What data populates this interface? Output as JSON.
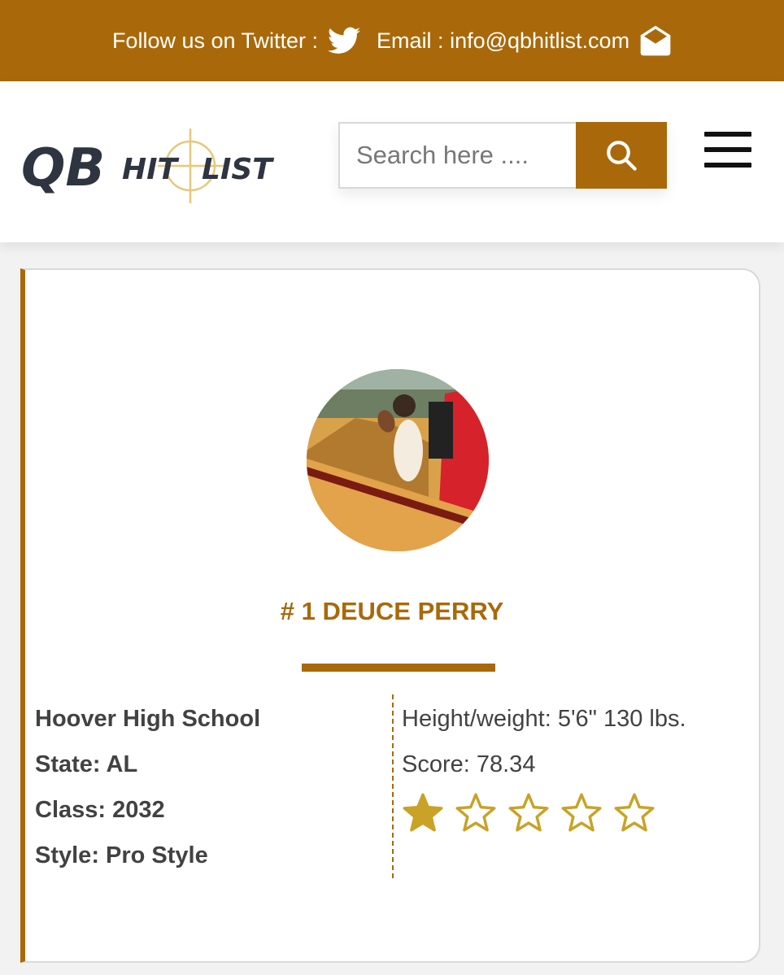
{
  "topbar": {
    "twitter_text": "Follow us on Twitter :",
    "email_text": "Email : info@qbhitlist.com",
    "twitter_icon": "twitter-bird-icon",
    "email_icon": "envelope-open-icon"
  },
  "header": {
    "logo_text": "QB HIT LIST",
    "search_placeholder": "Search here ....",
    "search_icon": "search-icon",
    "menu_icon": "hamburger-menu-icon"
  },
  "player": {
    "title": "# 1 DEUCE PERRY",
    "school": "Hoover High School",
    "state": "State: AL",
    "class": "Class: 2032",
    "style": "Style: Pro Style",
    "height_weight": "Height/weight: 5'6\" 130 lbs.",
    "score": "Score: 78.34",
    "rating": 1,
    "rating_max": 5
  },
  "colors": {
    "brand": "#a9690a",
    "star": "#c9a227"
  }
}
